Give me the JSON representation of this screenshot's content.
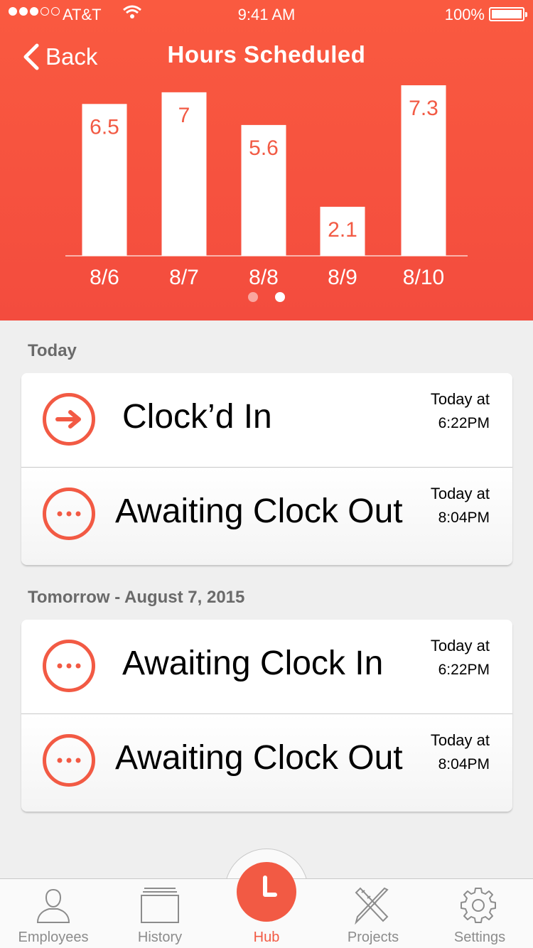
{
  "status_bar": {
    "carrier": "AT&T",
    "time": "9:41 AM",
    "battery": "100%"
  },
  "nav": {
    "back_label": "Back",
    "title": "Hours Scheduled"
  },
  "chart_data": {
    "type": "bar",
    "categories": [
      "8/6",
      "8/7",
      "8/8",
      "8/9",
      "8/10"
    ],
    "values": [
      6.5,
      7,
      5.6,
      2.1,
      7.3
    ],
    "data_labels": [
      "6.5",
      "7",
      "5.6",
      "2.1",
      "7.3"
    ],
    "title": "Hours Scheduled",
    "ylim": [
      0,
      7.3
    ],
    "grid": false,
    "bar_color": "#ffffff",
    "label_color": "#f25a44"
  },
  "pager": {
    "pages": 2,
    "active": 2
  },
  "sections": [
    {
      "label": "Today",
      "rows": [
        {
          "icon": "arrow-right-icon",
          "label": "Clock’d In",
          "when_line1": "Today at",
          "when_line2": "6:22PM"
        },
        {
          "icon": "ellipsis-icon",
          "label": "Awaiting Clock Out",
          "when_line1": "Today at",
          "when_line2": "8:04PM"
        }
      ]
    },
    {
      "label": "Tomorrow - August 7, 2015",
      "rows": [
        {
          "icon": "ellipsis-icon",
          "label": "Awaiting Clock In",
          "when_line1": "Today at",
          "when_line2": "6:22PM"
        },
        {
          "icon": "ellipsis-icon",
          "label": "Awaiting Clock Out",
          "when_line1": "Today at",
          "when_line2": "8:04PM"
        }
      ]
    }
  ],
  "tabs": [
    {
      "label": "Employees",
      "icon": "person-icon"
    },
    {
      "label": "History",
      "icon": "stack-icon"
    },
    {
      "label": "Hub",
      "icon": "clock-icon"
    },
    {
      "label": "Projects",
      "icon": "pencil-ruler-icon"
    },
    {
      "label": "Settings",
      "icon": "gear-icon"
    }
  ],
  "colors": {
    "accent": "#f25a44",
    "header_top": "#fa5a40",
    "header_bottom": "#f34c3e",
    "tab_inactive": "#8c8c8c",
    "background": "#efefef"
  }
}
